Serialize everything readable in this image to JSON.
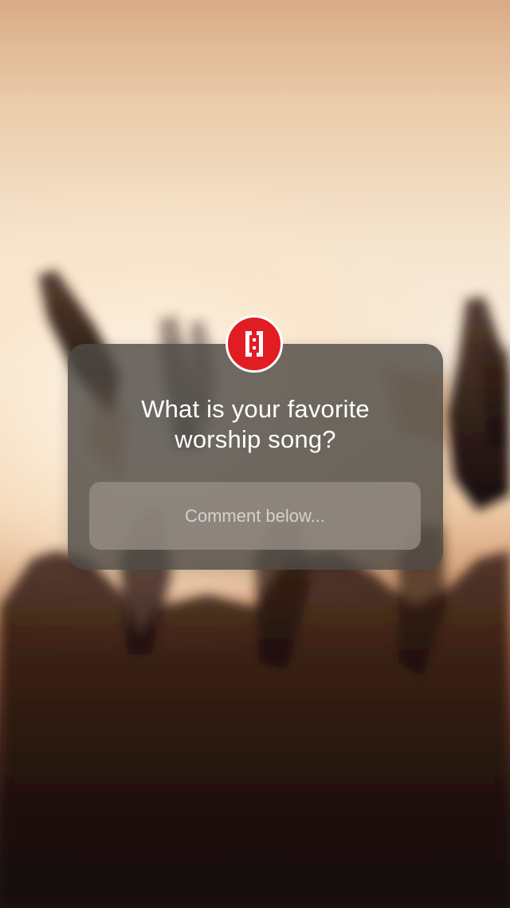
{
  "story": {
    "question_lines": [
      "What is your favorite",
      "worship song?"
    ],
    "comment_placeholder": "Comment below..."
  },
  "brand": {
    "logo_icon": "brand-logo-icon",
    "accent": "#e11d24"
  }
}
